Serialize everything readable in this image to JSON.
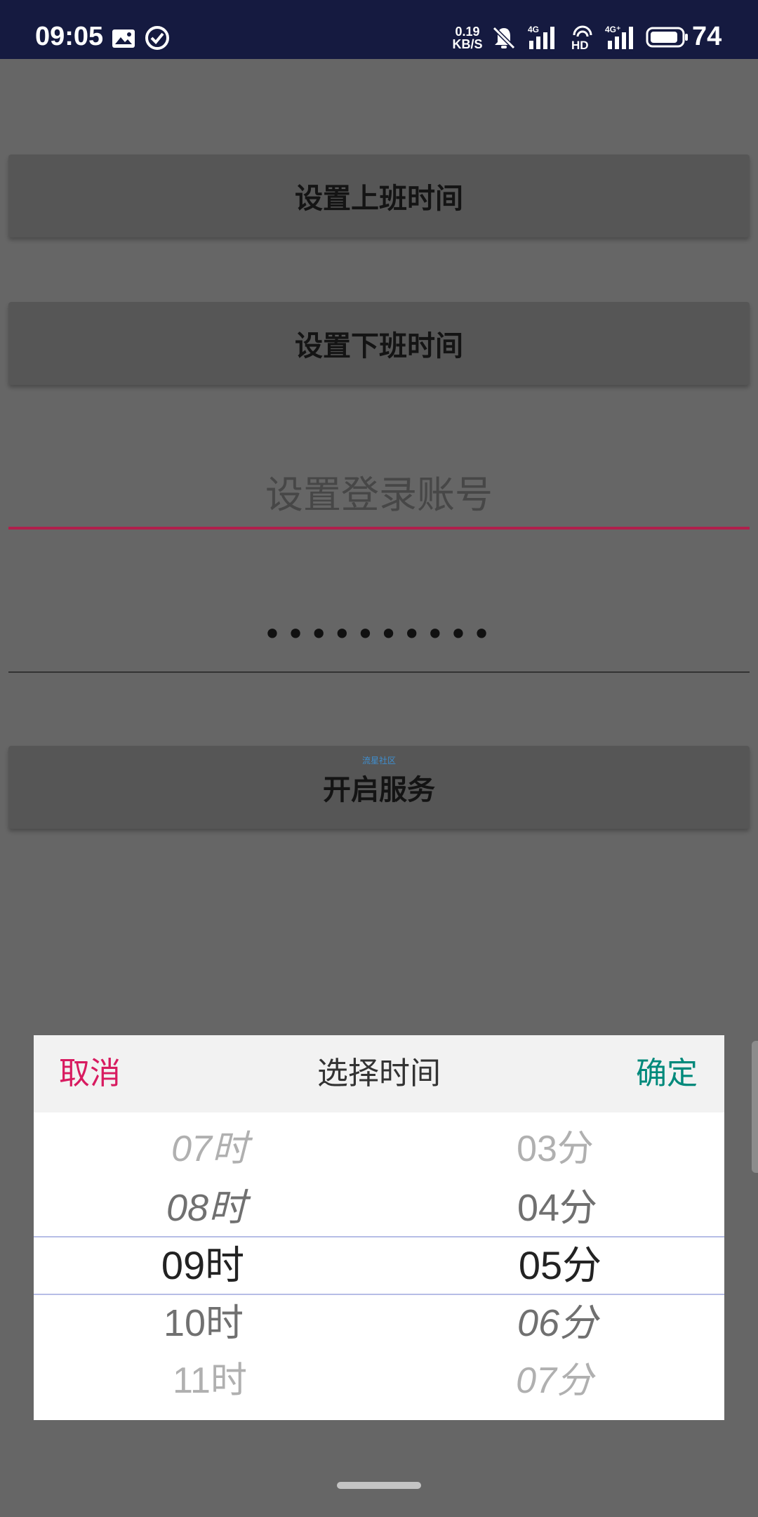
{
  "status_bar": {
    "time": "09:05",
    "net_speed_value": "0.19",
    "net_speed_unit": "KB/S",
    "battery_level": "74",
    "icons": [
      "image-icon",
      "check-circle-icon",
      "mute-bell-icon",
      "signal-4g-icon",
      "hd-icon",
      "signal-4g-plus-icon",
      "battery-icon"
    ]
  },
  "form": {
    "set_start_time_label": "设置上班时间",
    "set_end_time_label": "设置下班时间",
    "account_placeholder": "设置登录账号",
    "password_value": "••••••••••",
    "start_service_label": "开启服务",
    "watermark": "流星社区"
  },
  "dialog": {
    "cancel": "取消",
    "title": "选择时间",
    "confirm": "确定",
    "hours": [
      "07时",
      "08时",
      "09时",
      "10时",
      "11时"
    ],
    "minutes": [
      "03分",
      "04分",
      "05分",
      "06分",
      "07分"
    ],
    "selected_hour": "09时",
    "selected_minute": "05分"
  },
  "colors": {
    "cancel": "#d81b60",
    "confirm": "#00897b",
    "status_bar": "#151a40",
    "focused_underline": "#b0204c"
  }
}
